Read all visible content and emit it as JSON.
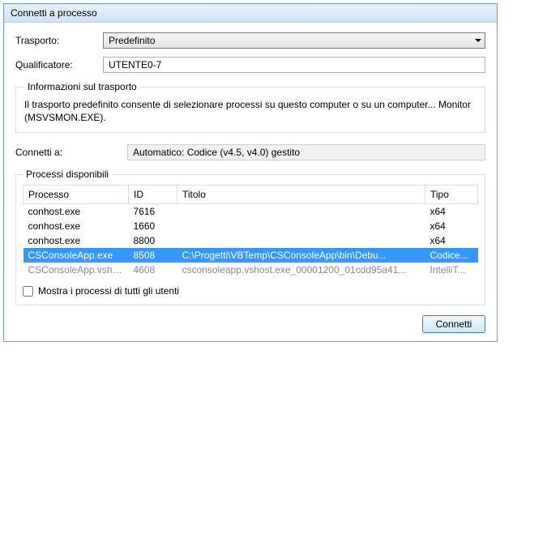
{
  "dialog": {
    "title": "Connetti a processo"
  },
  "transport": {
    "label": "Trasporto:",
    "value": "Predefinito"
  },
  "qualifier": {
    "label": "Qualificatore:",
    "value": "UTENTE0-7"
  },
  "info": {
    "legend": "Informazioni sul trasporto",
    "text": "Il trasporto predefinito consente di selezionare processi su questo computer o su un computer... Monitor (MSVSMON.EXE)."
  },
  "connect_to": {
    "label": "Connetti a:",
    "value": "Automatico: Codice (v4.5, v4.0) gestito"
  },
  "processes": {
    "legend": "Processi disponibili",
    "columns": {
      "process": "Processo",
      "id": "ID",
      "title": "Titolo",
      "type": "Tipo"
    },
    "rows": [
      {
        "process": "conhost.exe",
        "id": "7616",
        "title": "",
        "type": "x64",
        "selected": false,
        "disabled": false
      },
      {
        "process": "conhost.exe",
        "id": "1660",
        "title": "",
        "type": "x64",
        "selected": false,
        "disabled": false
      },
      {
        "process": "conhost.exe",
        "id": "8800",
        "title": "",
        "type": "x64",
        "selected": false,
        "disabled": false
      },
      {
        "process": "CSConsoleApp.exe",
        "id": "8508",
        "title": "C:\\Progetti\\VBTemp\\CSConsoleApp\\bin\\Debu...",
        "type": "Codice...",
        "selected": true,
        "disabled": false
      },
      {
        "process": "CSConsoleApp.vshos...",
        "id": "4608",
        "title": "csconsoleapp.vshost.exe_00001200_01cdd95a41...",
        "type": "IntelliT...",
        "selected": false,
        "disabled": true
      }
    ]
  },
  "show_all": {
    "label": "Mostra i processi di tutti gli utenti"
  },
  "buttons": {
    "connect": "Connetti"
  }
}
